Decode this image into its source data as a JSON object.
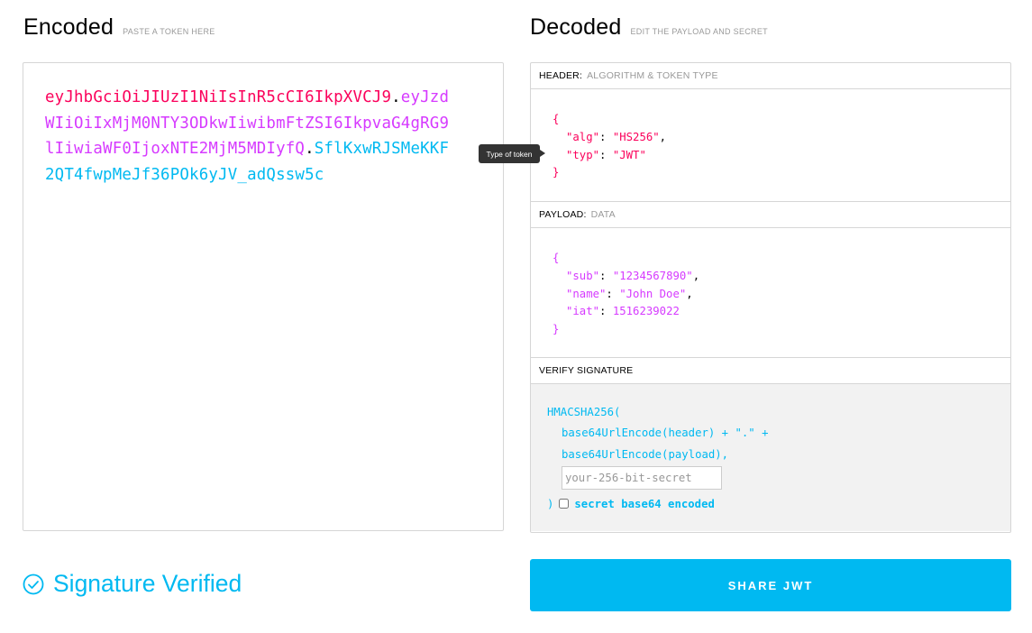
{
  "encoded": {
    "title": "Encoded",
    "hint": "PASTE A TOKEN HERE",
    "token_header": "eyJhbGciOiJIUzI1NiIsInR5cCI6IkpXVCJ9",
    "token_payload": "eyJzdWIiOiIxMjM0NTY3ODkwIiwibmFtZSI6IkpvaG4gRG9lIiwiaWF0IjoxNTE2MjM5MDIyfQ",
    "token_signature": "SflKxwRJSMeKKF2QT4fwpMeJf36POk6yJV_adQssw5c",
    "dot": "."
  },
  "decoded": {
    "title": "Decoded",
    "hint": "EDIT THE PAYLOAD AND SECRET",
    "header": {
      "label": "HEADER:",
      "sublabel": "ALGORITHM & TOKEN TYPE",
      "open": "{",
      "close": "}",
      "lines": [
        {
          "key": "\"alg\"",
          "sep": ": ",
          "value": "\"HS256\"",
          "comma": ","
        },
        {
          "key": "\"typ\"",
          "sep": ": ",
          "value": "\"JWT\"",
          "comma": ""
        }
      ]
    },
    "payload": {
      "label": "PAYLOAD:",
      "sublabel": "DATA",
      "open": "{",
      "close": "}",
      "lines": [
        {
          "key": "\"sub\"",
          "sep": ": ",
          "value": "\"1234567890\"",
          "comma": ","
        },
        {
          "key": "\"name\"",
          "sep": ": ",
          "value": "\"John Doe\"",
          "comma": ","
        },
        {
          "key": "\"iat\"",
          "sep": ": ",
          "value": "1516239022",
          "comma": ""
        }
      ]
    },
    "verify": {
      "label": "VERIFY SIGNATURE",
      "line1": "HMACSHA256(",
      "line2": "base64UrlEncode(header) + \".\" +",
      "line3": "base64UrlEncode(payload),",
      "secret_placeholder": "your-256-bit-secret",
      "close": ")",
      "checkbox_label": "secret base64 encoded",
      "checkbox_checked": false
    }
  },
  "tooltip": "Type of token",
  "status": {
    "text": "Signature Verified",
    "icon": "check-circle-icon"
  },
  "share_button": "SHARE JWT",
  "colors": {
    "header": "#fb015b",
    "payload": "#d63aff",
    "signature": "#00b9f1",
    "accent": "#00b9f1"
  }
}
